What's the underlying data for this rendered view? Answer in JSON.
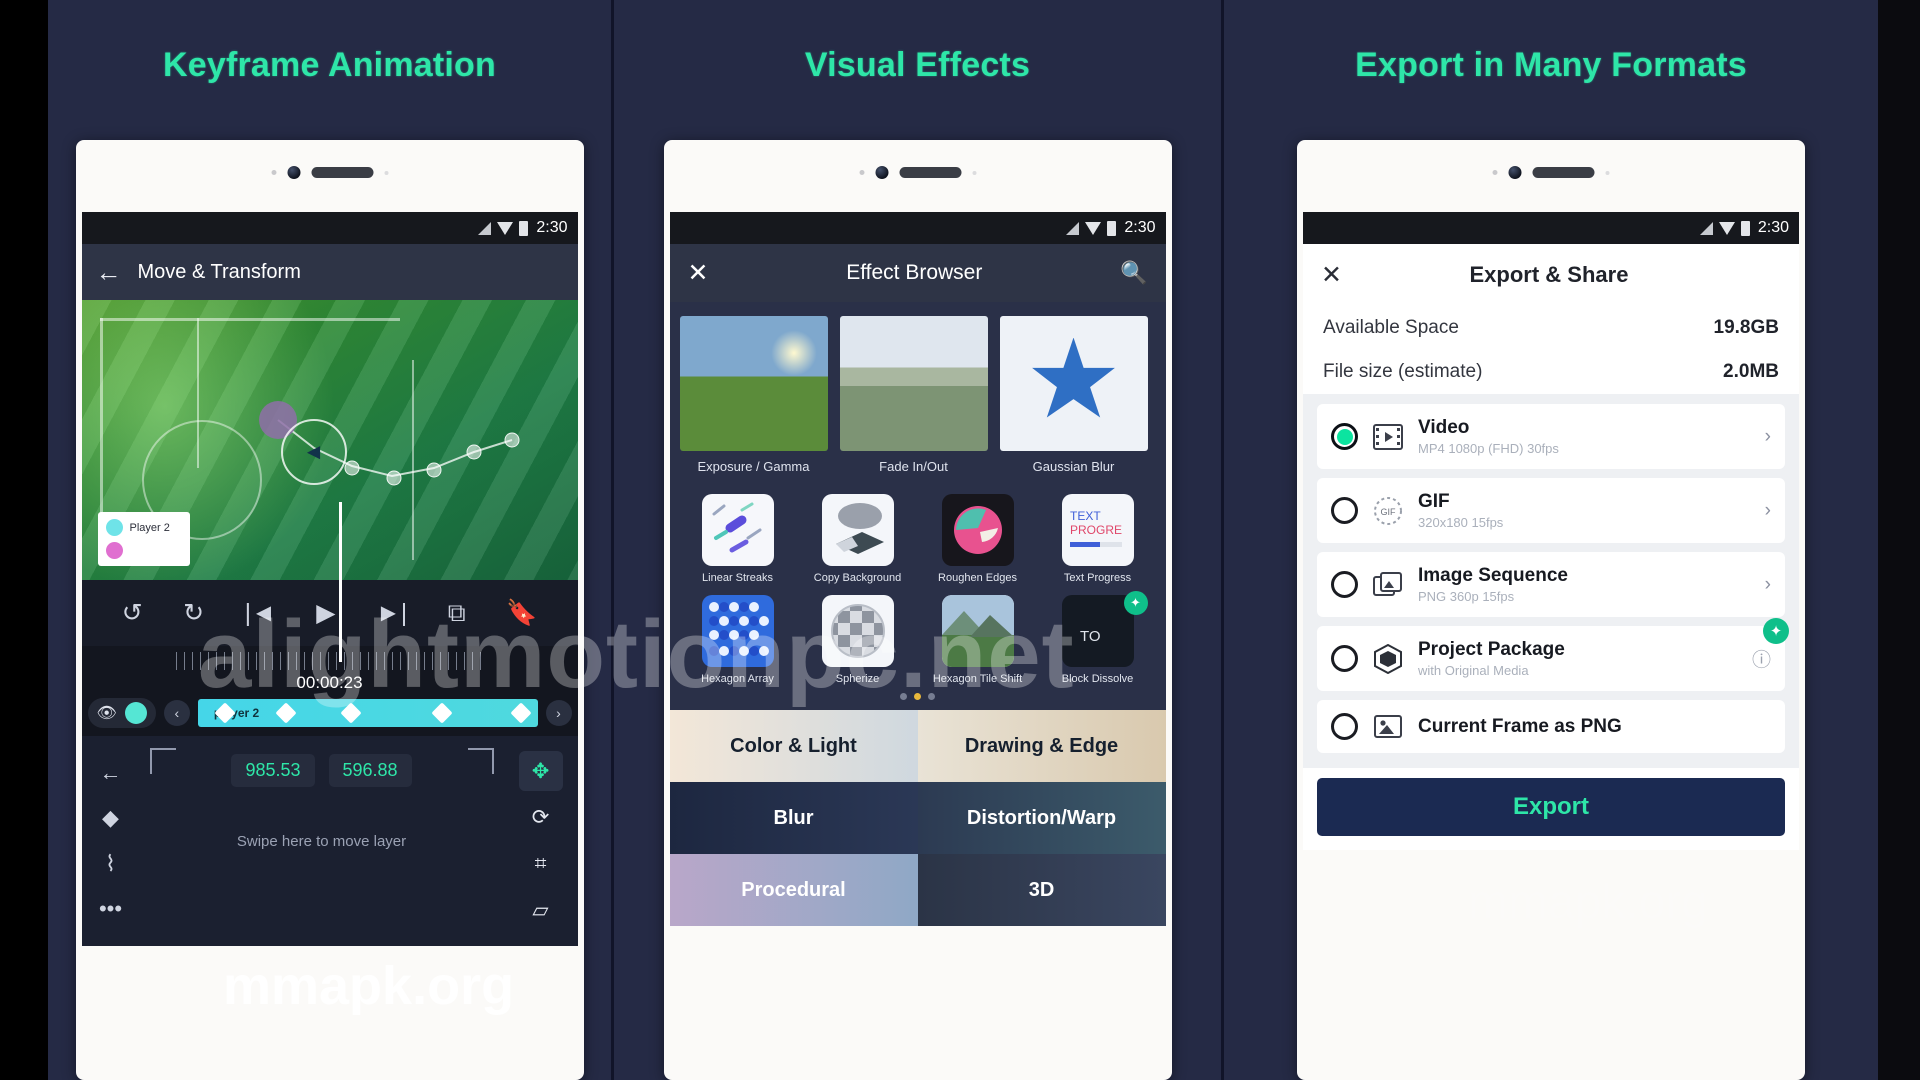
{
  "panels": [
    {
      "heading": "Keyframe Animation"
    },
    {
      "heading": "Visual Effects"
    },
    {
      "heading": "Export in Many Formats"
    }
  ],
  "status_bar": {
    "time": "2:30"
  },
  "phone1": {
    "toolbar": {
      "back_icon": "arrow-left-icon",
      "title": "Move & Transform"
    },
    "legend": {
      "label": "Player 2",
      "color_a": "#6fe3e8",
      "color_b": "#e06fd0"
    },
    "tools": [
      "undo-icon",
      "redo-icon",
      "skip-start-icon",
      "play-icon",
      "skip-end-icon",
      "duplicate-icon",
      "bookmark-icon"
    ],
    "timecode": "00:00:23",
    "track": {
      "eye_icon": "eye-icon",
      "clip_label": "player 2",
      "keyframes": [
        8,
        26,
        45,
        72,
        95
      ]
    },
    "params": {
      "x": "985.53",
      "y": "596.88",
      "hint": "Swipe here to move layer"
    },
    "left_icons": [
      "arrow-left-icon",
      "keyframe-diamond-icon",
      "easing-curve-icon",
      "more-dots-icon"
    ],
    "right_icons": [
      "move-icon",
      "rotate-icon",
      "crop-icon",
      "skew-icon"
    ]
  },
  "phone2": {
    "toolbar": {
      "close_icon": "close-icon",
      "title": "Effect Browser",
      "search_icon": "search-icon"
    },
    "featured": [
      {
        "label": "Exposure / Gamma"
      },
      {
        "label": "Fade In/Out"
      },
      {
        "label": "Gaussian Blur"
      }
    ],
    "effects": [
      {
        "label": "Linear Streaks"
      },
      {
        "label": "Copy Background"
      },
      {
        "label": "Roughen Edges"
      },
      {
        "label": "Text Progress"
      },
      {
        "label": "Hexagon Array"
      },
      {
        "label": "Spherize"
      },
      {
        "label": "Hexagon Tile Shift"
      },
      {
        "label": "Block Dissolve"
      }
    ],
    "page_dots": {
      "count": 3,
      "active_index": 1
    },
    "categories": [
      {
        "label": "Color & Light"
      },
      {
        "label": "Drawing & Edge"
      },
      {
        "label": "Blur"
      },
      {
        "label": "Distortion/Warp"
      },
      {
        "label": "Procedural"
      },
      {
        "label": "3D"
      }
    ]
  },
  "phone3": {
    "toolbar": {
      "close_icon": "close-icon",
      "title": "Export & Share"
    },
    "info": [
      {
        "key": "Available Space",
        "value": "19.8GB"
      },
      {
        "key": "File size (estimate)",
        "value": "2.0MB"
      }
    ],
    "options": [
      {
        "title": "Video",
        "subtitle": "MP4 1080p (FHD) 30fps",
        "icon": "film-icon",
        "selected": true,
        "chevron": "›",
        "badge": ""
      },
      {
        "title": "GIF",
        "subtitle": "320x180 15fps",
        "icon": "gif-icon",
        "selected": false,
        "chevron": "›",
        "badge": ""
      },
      {
        "title": "Image Sequence",
        "subtitle": "PNG 360p 15fps",
        "icon": "images-icon",
        "selected": false,
        "chevron": "›",
        "badge": ""
      },
      {
        "title": "Project Package",
        "subtitle": "with Original Media",
        "icon": "package-icon",
        "selected": false,
        "chevron": "ⓘ",
        "badge": "✦"
      },
      {
        "title": "Current Frame as PNG",
        "subtitle": "",
        "icon": "image-icon",
        "selected": false,
        "chevron": "",
        "badge": ""
      }
    ],
    "export_button": "Export"
  },
  "watermarks": {
    "big": "alightmotionpc.net",
    "mmapk": "mmapk.org",
    "faint": "mmapk.org"
  },
  "colors": {
    "background": "#252a45",
    "heading": "#2ee6a8",
    "accent": "#0ce4a0",
    "export_button_bg": "#1b2a52"
  }
}
